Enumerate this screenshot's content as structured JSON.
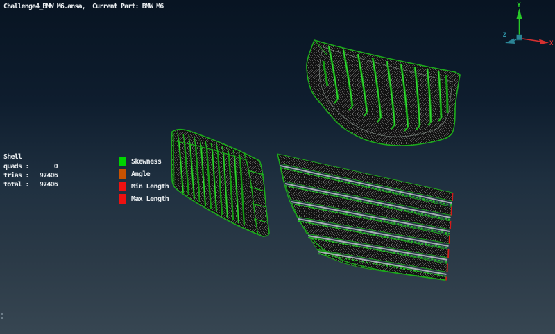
{
  "window": {
    "title": "Challenge4_BMW M6.ansa,  Current Part: BMW M6"
  },
  "shell_stats": {
    "group_label": "Shell",
    "rows": [
      {
        "label": "quads :",
        "value": "0"
      },
      {
        "label": "trias :",
        "value": "97406"
      },
      {
        "label": "total :",
        "value": "97406"
      }
    ]
  },
  "quality_legend": {
    "items": [
      {
        "label": "Skewness",
        "color": "#00d400"
      },
      {
        "label": "Angle",
        "color": "#c85200"
      },
      {
        "label": "Min Length",
        "color": "#ee1111"
      },
      {
        "label": "Max Length",
        "color": "#ee1111"
      }
    ]
  },
  "axis_triad": {
    "x": {
      "label": "X",
      "color": "#e03434"
    },
    "y": {
      "label": "Y",
      "color": "#2bd42b"
    },
    "z": {
      "label": "Z",
      "color": "#2f93a6"
    }
  },
  "viewport_colors": {
    "mesh_edge_green": "#1bab1b",
    "quality_violation_red": "#d41a1a",
    "background_top": "#081422",
    "background_bottom": "#374652"
  }
}
